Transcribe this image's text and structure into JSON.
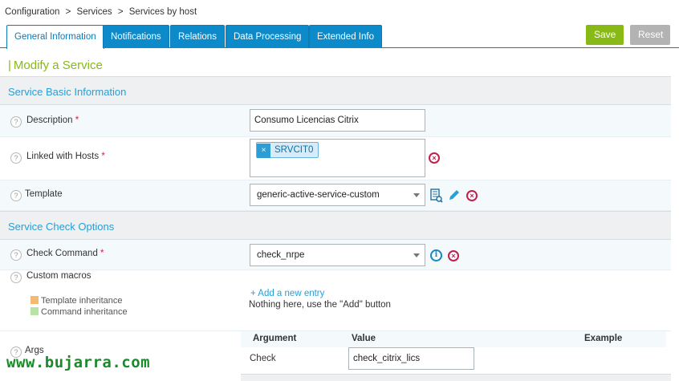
{
  "breadcrumb": [
    "Configuration",
    ">",
    "Services",
    ">",
    "Services by host"
  ],
  "tabs": [
    {
      "label": "General Information",
      "active": true
    },
    {
      "label": "Notifications",
      "active": false
    },
    {
      "label": "Relations",
      "active": false
    },
    {
      "label": "Data Processing",
      "active": false
    },
    {
      "label": "Extended Info",
      "active": false
    }
  ],
  "actions": {
    "save": "Save",
    "reset": "Reset"
  },
  "page_title": "Modify a Service",
  "sections": {
    "basic": "Service Basic Information",
    "check": "Service Check Options"
  },
  "fields": {
    "description": {
      "label": "Description",
      "required": "*",
      "value": "Consumo Licencias Citrix"
    },
    "linked_hosts": {
      "label": "Linked with Hosts",
      "required": "*",
      "chips": [
        "SRVCIT0"
      ]
    },
    "template": {
      "label": "Template",
      "value": "generic-active-service-custom"
    },
    "check_command": {
      "label": "Check Command",
      "required": "*",
      "value": "check_nrpe"
    },
    "custom_macros": {
      "label": "Custom macros",
      "add_link": "+ Add a new entry",
      "empty_text": "Nothing here, use the \"Add\" button"
    },
    "args": {
      "label": "Args",
      "columns": [
        "Argument",
        "Value",
        "Example"
      ],
      "rows": [
        {
          "argument": "Check",
          "value": "check_citrix_lics",
          "example": ""
        }
      ]
    }
  },
  "legend": [
    {
      "label": "Template inheritance",
      "color": "#f5b971"
    },
    {
      "label": "Command inheritance",
      "color": "#b7e3a5"
    }
  ],
  "watermark": "www.bujarra.com",
  "colors": {
    "tab_blue": "#0c8ac9",
    "accent_green": "#88b917",
    "link_blue": "#2a9ed5",
    "danger": "#c21f4a"
  }
}
